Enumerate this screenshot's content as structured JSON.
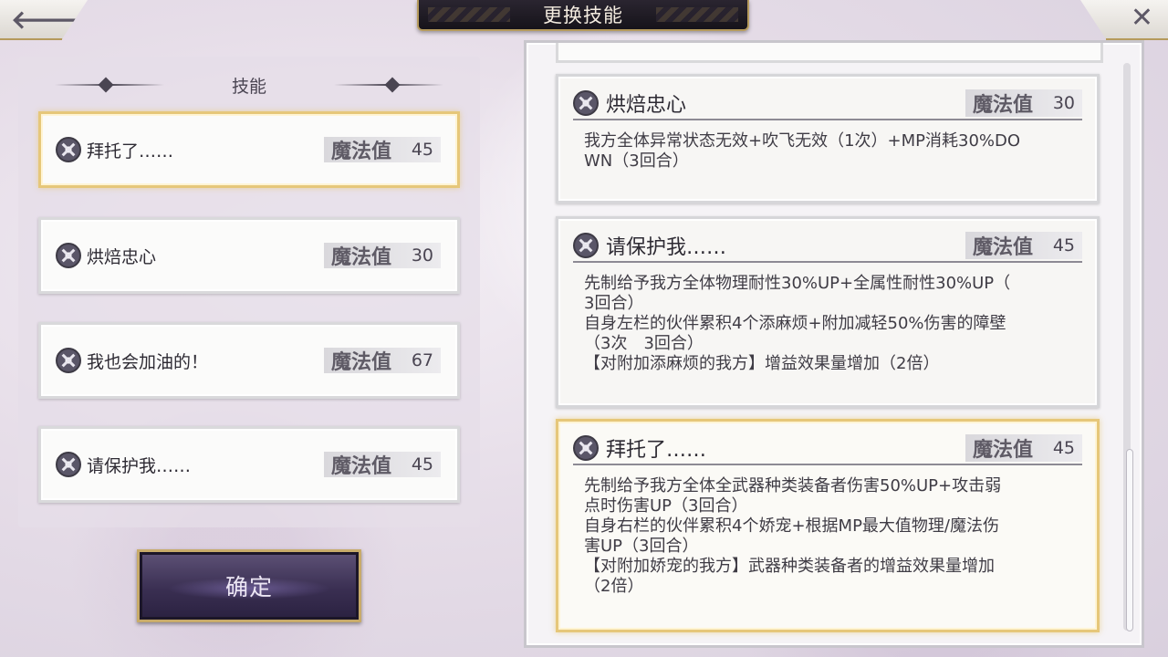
{
  "window": {
    "title": "更换技能"
  },
  "left_panel": {
    "title": "技能",
    "mp_label": "魔法值",
    "skills": [
      {
        "name": "拜托了……",
        "mp": "45",
        "selected": true
      },
      {
        "name": "烘焙忠心",
        "mp": "30",
        "selected": false
      },
      {
        "name": "我也会加油的！",
        "mp": "67",
        "selected": false
      },
      {
        "name": "请保护我……",
        "mp": "45",
        "selected": false
      }
    ],
    "confirm_label": "确定"
  },
  "right_panel": {
    "mp_label": "魔法值",
    "cards": [
      {
        "name": "烘焙忠心",
        "mp": "30",
        "description": "我方全体异常状态无效+吹飞无效（1次）+MP消耗30%DO\nWN（3回合）",
        "selected": false
      },
      {
        "name": "请保护我……",
        "mp": "45",
        "description": "先制给予我方全体物理耐性30%UP+全属性耐性30%UP（\n3回合）\n自身左栏的伙伴累积4个添麻烦+附加减轻50%伤害的障壁\n（3次　3回合）\n【对附加添麻烦的我方】增益效果量增加（2倍）",
        "selected": false
      },
      {
        "name": "拜托了……",
        "mp": "45",
        "description": "先制给予我方全体全武器种类装备者伤害50%UP+攻击弱\n点时伤害UP（3回合）\n自身右栏的伙伴累积4个娇宠+根据MP最大值物理/魔法伤\n害UP（3回合）\n【对附加娇宠的我方】武器种类装备者的增益效果量增加\n（2倍）",
        "selected": true
      }
    ],
    "scroll_position": 0.85
  },
  "icons": {
    "back": "back-arrow-icon",
    "close": "close-icon",
    "skill": "skill-emblem-icon"
  },
  "colors": {
    "accent_gold": "#e6c77a",
    "title_plate": "#1e1a24",
    "button_purple": "#3a2f52"
  }
}
